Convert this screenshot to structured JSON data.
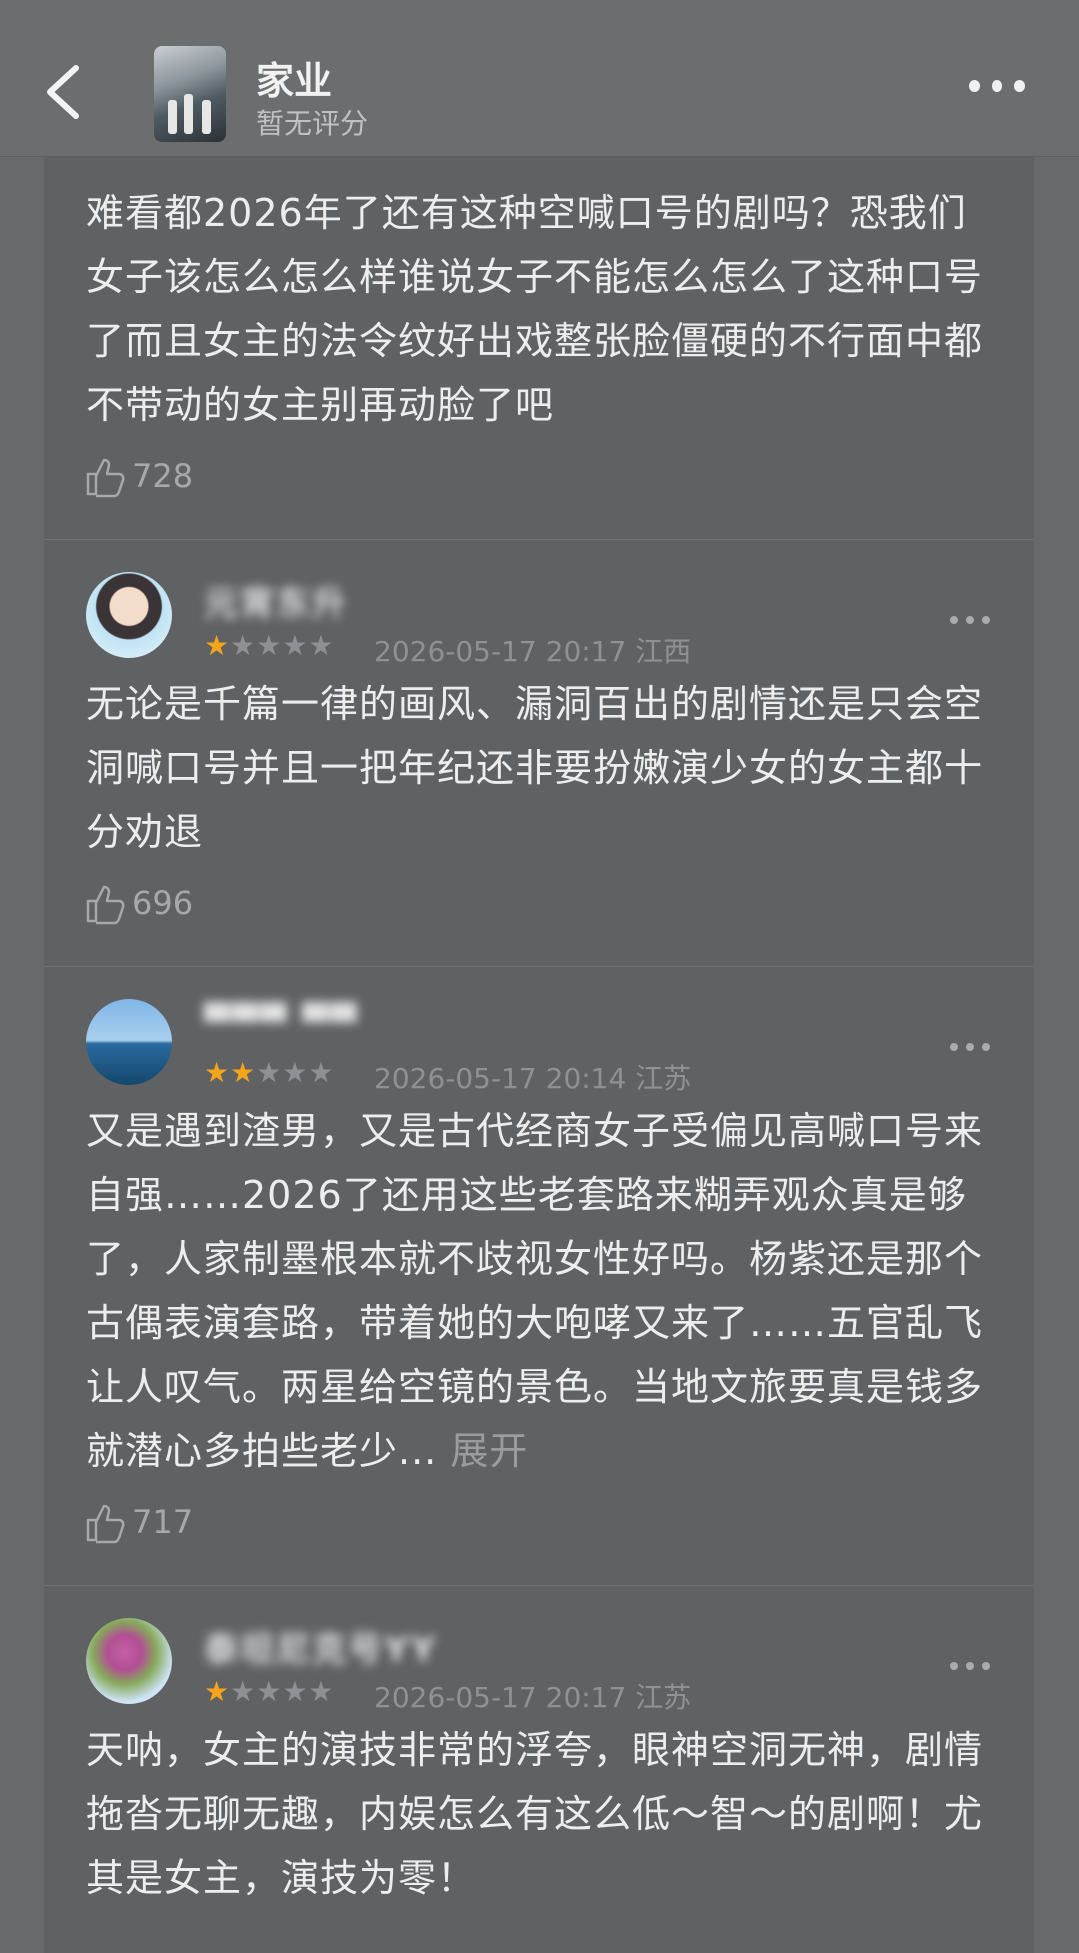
{
  "header": {
    "back_icon": "chevron-left-icon",
    "title": "家业",
    "subtitle": "暂无评分",
    "more_icon": "more-horizontal-icon"
  },
  "reviews": [
    {
      "username": "",
      "rating": null,
      "date": "",
      "location": "",
      "text": "难看都2026年了还有这种空喊口号的剧吗？恐我们女子该怎么怎么样谁说女子不能怎么怎么了这种口号了而且女主的法令纹好出戏整张脸僵硬的不行面中都不带动的女主别再动脸了吧",
      "expand": "",
      "likes": "728"
    },
    {
      "username": "元宵东升",
      "rating": 1,
      "date": "2026-05-17 20:17",
      "location": "江西",
      "text": "无论是千篇一律的画风、漏洞百出的剧情还是只会空洞喊口号并且一把年纪还非要扮嫩演少女的女主都十分劝退",
      "expand": "",
      "likes": "696"
    },
    {
      "username": "▀▀▀ ▀▀",
      "rating": 2,
      "date": "2026-05-17 20:14",
      "location": "江苏",
      "text": "又是遇到渣男，又是古代经商女子受偏见高喊口号来自强……2026了还用这些老套路来糊弄观众真是够了，人家制墨根本就不歧视女性好吗。杨紫还是那个古偶表演套路，带着她的大咆哮又来了……五官乱飞让人叹气。两星给空镜的景色。当地文旅要真是钱多就潜心多拍些老少...",
      "expand": "展开",
      "likes": "717"
    },
    {
      "username": "泰坦尼克号YY",
      "rating": 1,
      "date": "2026-05-17 20:17",
      "location": "江苏",
      "text": "天呐，女主的演技非常的浮夸，眼神空洞无神，剧情拖沓无聊无趣，内娱怎么有这么低～智～的剧啊！尤其是女主，演技为零！",
      "expand": "",
      "likes": ""
    }
  ],
  "colors": {
    "background": "#67696b",
    "card": "#5f6163",
    "star_on": "#f4a51c",
    "star_off": "#8e9093",
    "meta_text": "#8f9194"
  },
  "icons": {
    "like": "thumbs-up-icon",
    "review_more": "more-dots-icon"
  }
}
